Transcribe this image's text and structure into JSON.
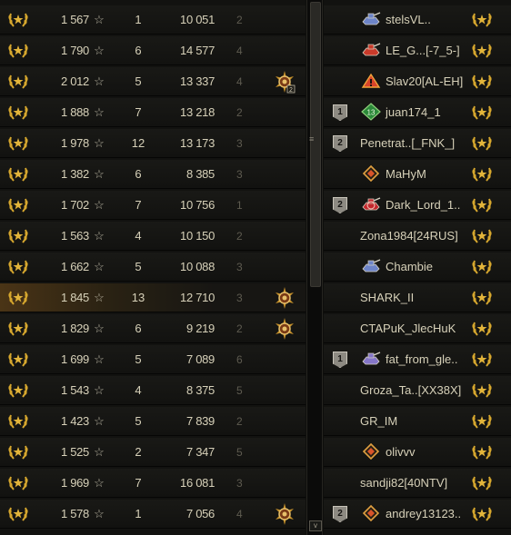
{
  "left_rows": [
    {
      "rating": "1 567",
      "battles": "1",
      "exp": "10 051",
      "rank": "2",
      "medal": false
    },
    {
      "rating": "1 790",
      "battles": "6",
      "exp": "14 577",
      "rank": "4",
      "medal": false
    },
    {
      "rating": "2 012",
      "battles": "5",
      "exp": "13 337",
      "rank": "4",
      "medal": true,
      "medal_badge": "2"
    },
    {
      "rating": "1 888",
      "battles": "7",
      "exp": "13 218",
      "rank": "2",
      "medal": false
    },
    {
      "rating": "1 978",
      "battles": "12",
      "exp": "13 173",
      "rank": "3",
      "medal": false
    },
    {
      "rating": "1 382",
      "battles": "6",
      "exp": "8 385",
      "rank": "3",
      "medal": false
    },
    {
      "rating": "1 702",
      "battles": "7",
      "exp": "10 756",
      "rank": "1",
      "medal": false
    },
    {
      "rating": "1 563",
      "battles": "4",
      "exp": "10 150",
      "rank": "2",
      "medal": false
    },
    {
      "rating": "1 662",
      "battles": "5",
      "exp": "10 088",
      "rank": "3",
      "medal": false
    },
    {
      "rating": "1 845",
      "battles": "13",
      "exp": "12 710",
      "rank": "3",
      "medal": true,
      "highlight": true
    },
    {
      "rating": "1 829",
      "battles": "6",
      "exp": "9 219",
      "rank": "2",
      "medal": true
    },
    {
      "rating": "1 699",
      "battles": "5",
      "exp": "7 089",
      "rank": "6",
      "medal": false
    },
    {
      "rating": "1 543",
      "battles": "4",
      "exp": "8 375",
      "rank": "5",
      "medal": false
    },
    {
      "rating": "1 423",
      "battles": "5",
      "exp": "7 839",
      "rank": "2",
      "medal": false
    },
    {
      "rating": "1 525",
      "battles": "2",
      "exp": "7 347",
      "rank": "5",
      "medal": false
    },
    {
      "rating": "1 969",
      "battles": "7",
      "exp": "16 081",
      "rank": "3",
      "medal": false
    },
    {
      "rating": "1 578",
      "battles": "1",
      "exp": "7 056",
      "rank": "4",
      "medal": true
    }
  ],
  "right_rows": [
    {
      "badge": "",
      "tank": "tank-blue-icon",
      "name": "stelsVL.."
    },
    {
      "badge": "",
      "tank": "tank-red-icon",
      "name": "LE_G...[-7_5-]"
    },
    {
      "badge": "",
      "tank": "triangle-red-icon",
      "name": "Slav20[AL-EH]"
    },
    {
      "badge": "1",
      "tank": "diamond-green-icon",
      "name": "juan174_1"
    },
    {
      "badge": "2",
      "tank": "",
      "name": "Penetrat..[_FNK_]"
    },
    {
      "badge": "",
      "tank": "diamond-orange-icon",
      "name": "MaHyM"
    },
    {
      "badge": "2",
      "tank": "tank-red-circle-icon",
      "name": "Dark_Lord_1.."
    },
    {
      "badge": "",
      "tank": "",
      "name": "Zona1984[24RUS]"
    },
    {
      "badge": "",
      "tank": "tank-blue-icon",
      "name": "Chambie"
    },
    {
      "badge": "",
      "tank": "",
      "name": "SHARK_II"
    },
    {
      "badge": "",
      "tank": "",
      "name": "CTAPuK_JlecHuK"
    },
    {
      "badge": "1",
      "tank": "tank-purple-icon",
      "name": "fat_from_gle.."
    },
    {
      "badge": "",
      "tank": "",
      "name": "Groza_Ta..[XX38X]"
    },
    {
      "badge": "",
      "tank": "",
      "name": "GR_IM"
    },
    {
      "badge": "",
      "tank": "diamond-orange-icon",
      "name": "olivvv"
    },
    {
      "badge": "",
      "tank": "",
      "name": "sandji82[40NTV]"
    },
    {
      "badge": "2",
      "tank": "diamond-orange-icon",
      "name": "andrey13123.."
    }
  ],
  "scrollbar": {
    "grip": "≡",
    "down": "v"
  },
  "colors": {
    "gold": "#d6a72e",
    "highlight": "#4a3416",
    "text": "#d7d1b9",
    "rank": "#5e5b50"
  }
}
